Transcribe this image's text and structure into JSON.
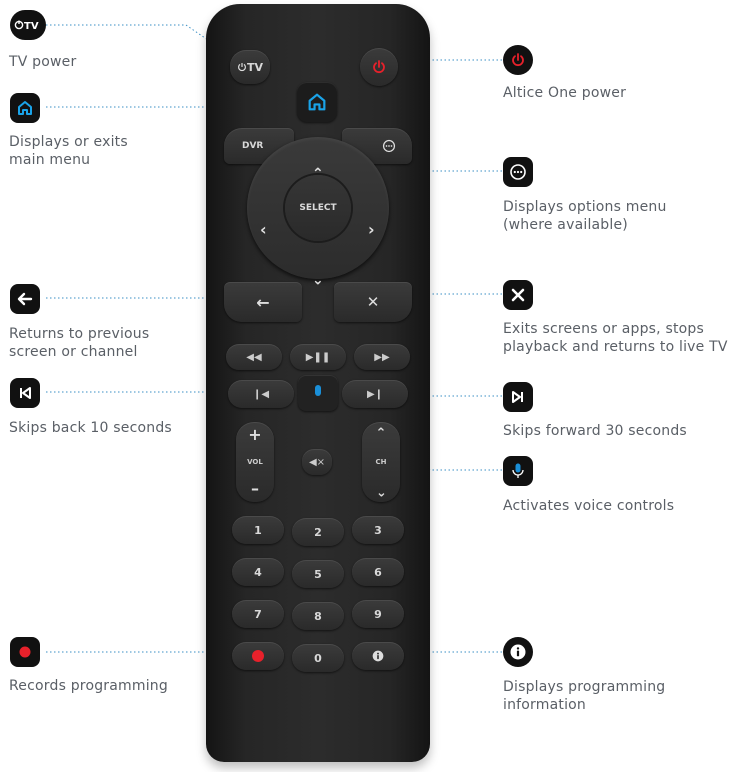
{
  "callouts": {
    "tv_power": "TV power",
    "home_line1": "Displays or exits",
    "home_line2": "main menu",
    "back_line1": "Returns to previous",
    "back_line2": "screen or channel",
    "skip_back": "Skips back 10 seconds",
    "record": "Records programming",
    "altice_power": "Altice One power",
    "options_line1": "Displays options menu",
    "options_line2": "(where available)",
    "exit_line1": "Exits screens or apps, stops",
    "exit_line2": "playback and returns to live TV",
    "skip_forward": "Skips forward 30 seconds",
    "voice": "Activates voice controls",
    "info_line1": "Displays programming",
    "info_line2": "information"
  },
  "remote_labels": {
    "tv_button": "TV",
    "dvr": "DVR",
    "select": "SELECT",
    "vol": "VOL",
    "ch": "CH",
    "digits": [
      "1",
      "2",
      "3",
      "4",
      "5",
      "6",
      "7",
      "8",
      "9",
      "0"
    ]
  },
  "icons": {
    "tv_power": "power-tv-icon",
    "home": "home-icon",
    "back": "back-arrow-icon",
    "skip_back": "skip-back-icon",
    "record": "record-icon",
    "altice_power": "power-icon",
    "options": "options-icon",
    "exit": "close-icon",
    "skip_forward": "skip-forward-icon",
    "voice": "microphone-icon",
    "info": "info-icon"
  },
  "colors": {
    "badge": "#111111",
    "home_accent": "#1aa3e8",
    "power_red": "#e8212b",
    "record_red": "#e8212b",
    "mic_blue": "#1a8fd8",
    "leader_line": "#3a8fc4",
    "label_text": "#5a5f66"
  }
}
